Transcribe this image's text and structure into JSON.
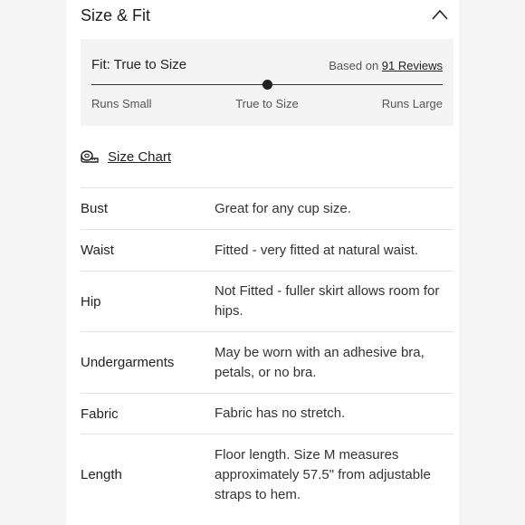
{
  "section": {
    "title": "Size & Fit",
    "collapse_icon": "chevron-up-icon"
  },
  "fit": {
    "prefix": "Fit: ",
    "value": "True to Size",
    "reviews_prefix": "Based on ",
    "reviews_link": "91 Reviews",
    "scale_position": 0.5,
    "scale": {
      "small": "Runs Small",
      "true": "True to Size",
      "large": "Runs Large"
    }
  },
  "size_chart": {
    "label": "Size Chart",
    "icon": "measuring-tape-icon"
  },
  "details": [
    {
      "label": "Bust",
      "value": "Great for any cup size."
    },
    {
      "label": "Waist",
      "value": "Fitted - very fitted at natural waist."
    },
    {
      "label": "Hip",
      "value": "Not Fitted - fuller skirt allows room for hips."
    },
    {
      "label": "Undergarments",
      "value": "May be worn with an adhesive bra, petals, or no bra."
    },
    {
      "label": "Fabric",
      "value": "Fabric has no stretch."
    },
    {
      "label": "Length",
      "value": "Floor length. Size M measures approximately 57.5\" from adjustable straps to hem."
    }
  ]
}
